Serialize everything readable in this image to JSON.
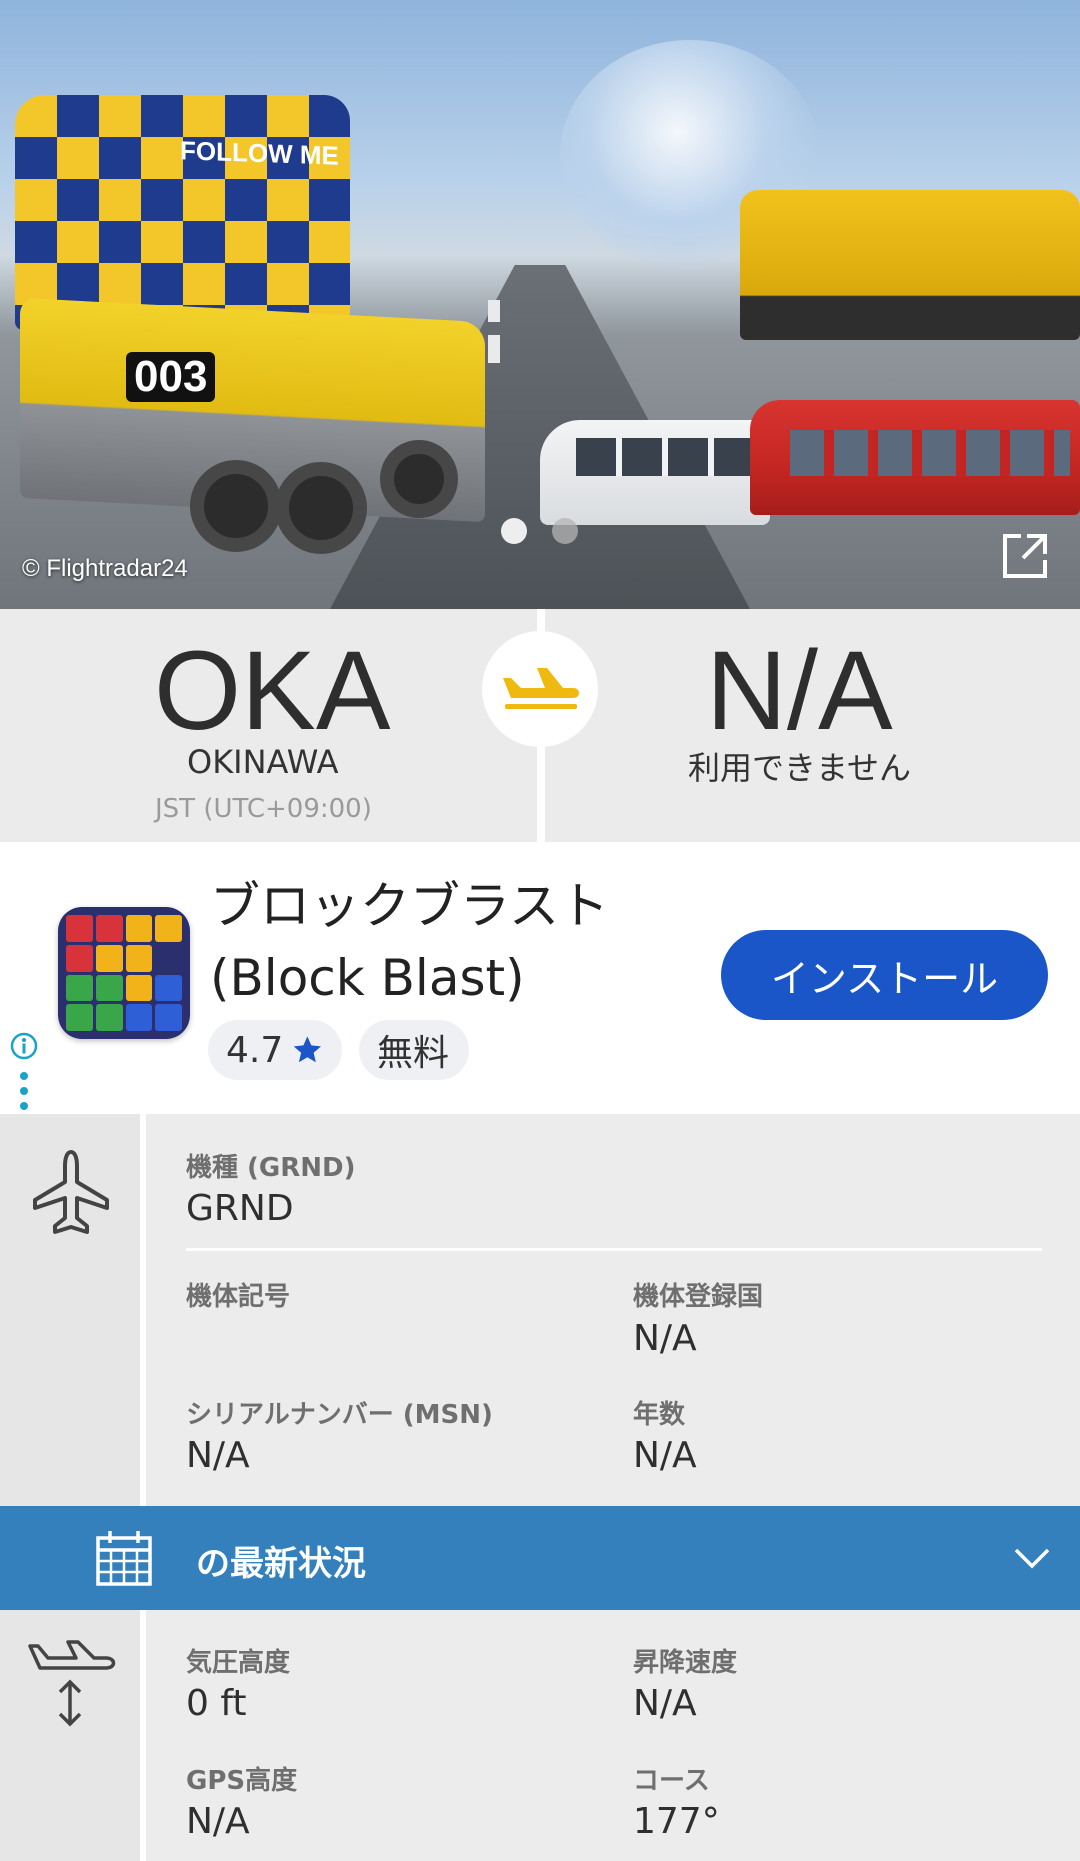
{
  "hero": {
    "credit": "© Flightradar24",
    "van_label": "FOLLOW ME",
    "truck_number": "003"
  },
  "route": {
    "from": {
      "code": "OKA",
      "city": "OKINAWA",
      "timezone": "JST (UTC+09:00)"
    },
    "to": {
      "code": "N/A",
      "city": "利用できません"
    },
    "status_icon": "plane-landing-icon",
    "accent": "#f0b90f"
  },
  "ad": {
    "app_name": "ブロックブラスト(Block Blast)",
    "rating": "4.7",
    "price": "無料",
    "install_label": "インストール",
    "install_color": "#1a56c8"
  },
  "aircraft": {
    "icon": "airplane-icon",
    "type_label": "機種 (GRND)",
    "type_value": "GRND",
    "registration_label": "機体記号",
    "registration_value": "",
    "country_label": "機体登録国",
    "country_value": "N/A",
    "serial_label": "シリアルナンバー (MSN)",
    "serial_value": "N/A",
    "age_label": "年数",
    "age_value": "N/A"
  },
  "section": {
    "title": "の最新状況",
    "color": "#3380bd"
  },
  "status": {
    "icon": "altitude-icon",
    "baro_alt_label": "気圧高度",
    "baro_alt_value": "0 ft",
    "vspeed_label": "昇降速度",
    "vspeed_value": "N/A",
    "gps_alt_label": "GPS高度",
    "gps_alt_value": "N/A",
    "track_label": "コース",
    "track_value": "177°"
  }
}
